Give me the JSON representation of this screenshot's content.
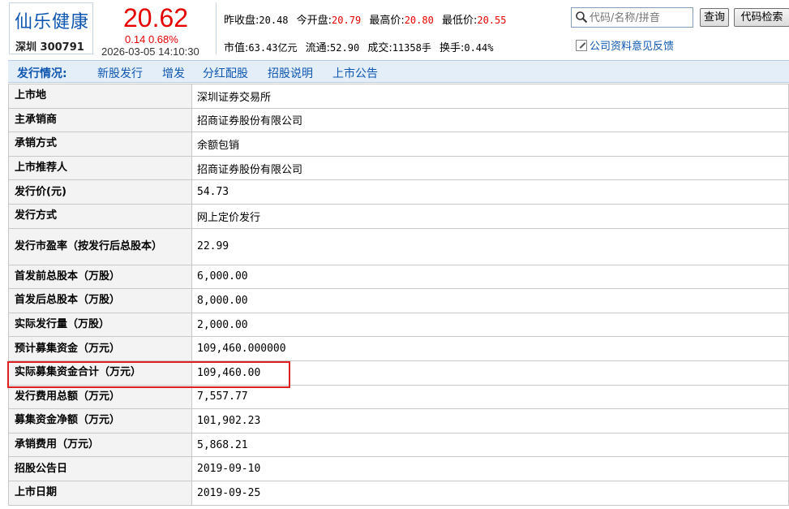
{
  "stock": {
    "name": "仙乐健康",
    "market": "深圳",
    "code": "300791",
    "price": "20.62",
    "change": "0.14",
    "change_pct": "0.68%",
    "time": "2026-03-05 14:10:30"
  },
  "quote": {
    "prev_close_label": "昨收盘:",
    "prev_close": "20.48",
    "open_label": "今开盘:",
    "open": "20.79",
    "high_label": "最高价:",
    "high": "20.80",
    "low_label": "最低价:",
    "low": "20.55",
    "mkt_cap_label": "市值:",
    "mkt_cap": "63.43亿元",
    "float_label": "流通:",
    "float": "52.90",
    "volume_label": "成交:",
    "volume": "11358手",
    "turnover_label": "换手:",
    "turnover": "0.44%"
  },
  "search": {
    "placeholder": "代码/名称/拼音",
    "query_button": "查询",
    "code_search_button": "代码检索",
    "feedback_link": "公司资料意见反馈"
  },
  "issue_tabs": {
    "title": "发行情况:",
    "items": [
      "新股发行",
      "增发",
      "分红配股",
      "招股说明",
      "上市公告"
    ]
  },
  "issue_table": [
    {
      "label": "上市地",
      "value": "深圳证券交易所"
    },
    {
      "label": "主承销商",
      "value": "招商证券股份有限公司"
    },
    {
      "label": "承销方式",
      "value": "余额包销"
    },
    {
      "label": "上市推荐人",
      "value": "招商证券股份有限公司"
    },
    {
      "label": "发行价(元)",
      "value": "54.73"
    },
    {
      "label": "发行方式",
      "value": "网上定价发行"
    },
    {
      "label": "发行市盈率（按发行后总股本）",
      "value": "22.99"
    },
    {
      "label": "首发前总股本（万股）",
      "value": "6,000.00"
    },
    {
      "label": "首发后总股本（万股）",
      "value": "8,000.00"
    },
    {
      "label": "实际发行量（万股）",
      "value": "2,000.00"
    },
    {
      "label": "预计募集资金（万元）",
      "value": "109,460.000000"
    },
    {
      "label": "实际募集资金合计（万元）",
      "value": "109,460.00"
    },
    {
      "label": "发行费用总额（万元）",
      "value": "7,557.77"
    },
    {
      "label": "募集资金净额（万元）",
      "value": "101,902.23"
    },
    {
      "label": "承销费用（万元）",
      "value": "5,868.21"
    },
    {
      "label": "招股公告日",
      "value": "2019-09-10"
    },
    {
      "label": "上市日期",
      "value": "2019-09-25"
    }
  ],
  "colors": {
    "accent_blue": "#0e56b0",
    "price_red": "#e60000",
    "highlight_red": "#e02020",
    "tabbar_bg": "#e4eef9"
  }
}
